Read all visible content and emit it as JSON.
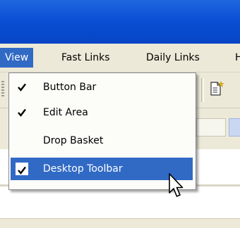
{
  "colors": {
    "title_blue": "#0a4ed4",
    "menu_bg": "#ece9d8",
    "highlight": "#316ac5",
    "dropdown_bg": "#fcfcf9"
  },
  "menubar": {
    "items": [
      {
        "label": "View"
      },
      {
        "label": "Fast Links"
      },
      {
        "label": "Daily Links"
      },
      {
        "label": "H"
      }
    ]
  },
  "view_menu": {
    "items": [
      {
        "label": "Button Bar",
        "checked": true
      },
      {
        "label": "Edit Area",
        "checked": true
      },
      {
        "label": "Drop Basket",
        "checked": false
      },
      {
        "label": "Desktop Toolbar",
        "checked": true,
        "highlighted": true
      }
    ]
  },
  "icons": [
    "checkmark-icon",
    "new-document-icon",
    "mouse-pointer-icon",
    "toolbar-grip-icon"
  ]
}
